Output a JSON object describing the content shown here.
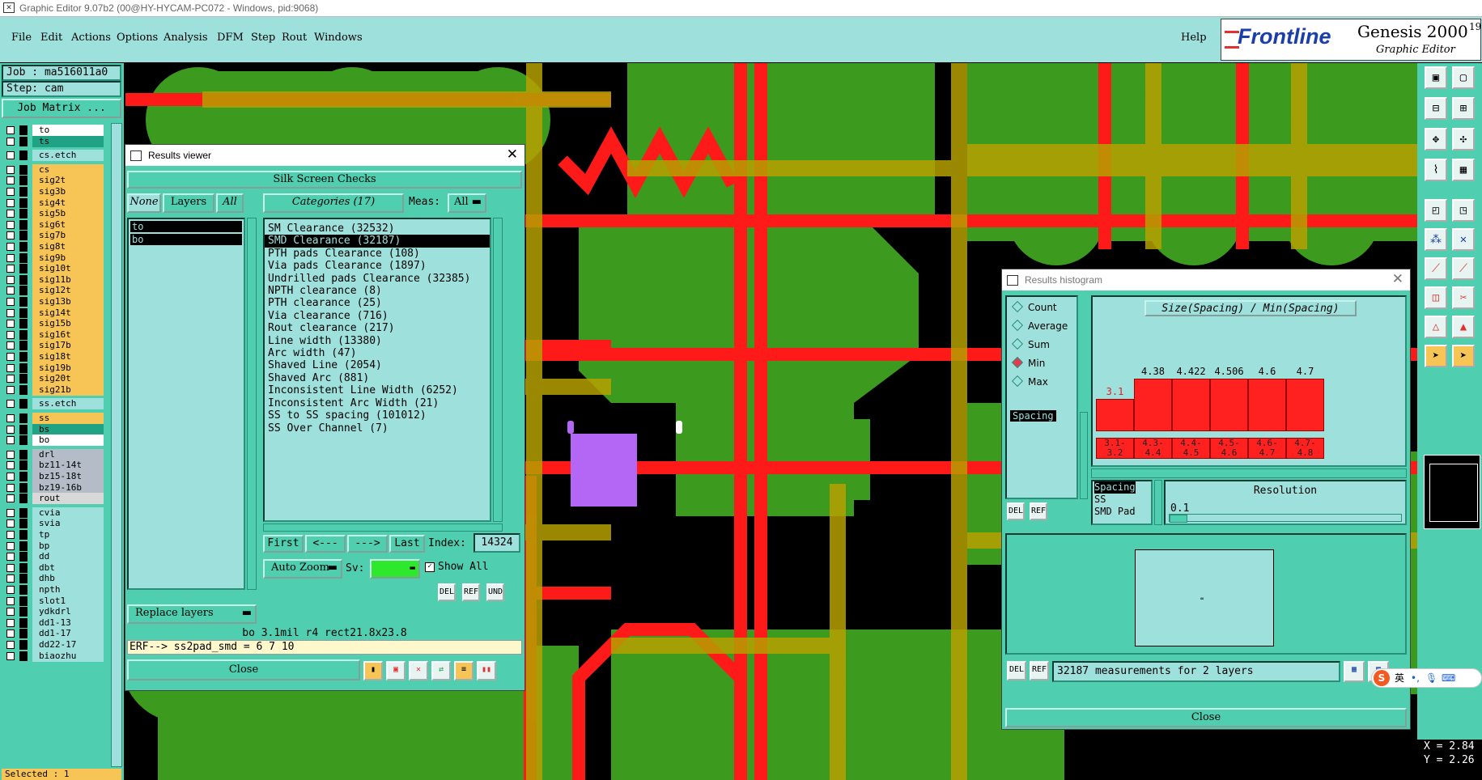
{
  "window": {
    "title": "Graphic Editor 9.07b2 (00@HY-HYCAM-PC072 - Windows, pid:9068)"
  },
  "menu": [
    "File",
    "Edit",
    "Actions",
    "Options",
    "Analysis",
    "DFM",
    "Step",
    "Rout",
    "Windows"
  ],
  "help": "Help",
  "brand": {
    "logo": "Frontline",
    "product": "Genesis 2000",
    "sup": "19",
    "sub": "Graphic Editor"
  },
  "job": {
    "job": "Job : ma516011a0",
    "step": "Step: cam",
    "matrix": "Job Matrix ..."
  },
  "layers": [
    {
      "name": "to",
      "color": "#ffffff"
    },
    {
      "name": "ts",
      "color": "#1fa384"
    },
    {
      "name": "cs.etch",
      "color": "#9ee0dc"
    },
    {
      "name": "cs",
      "color": "#f6c555"
    },
    {
      "name": "sig2t",
      "color": "#f6c555"
    },
    {
      "name": "sig3b",
      "color": "#f6c555"
    },
    {
      "name": "sig4t",
      "color": "#f6c555"
    },
    {
      "name": "sig5b",
      "color": "#f6c555"
    },
    {
      "name": "sig6t",
      "color": "#f6c555"
    },
    {
      "name": "sig7b",
      "color": "#f6c555"
    },
    {
      "name": "sig8t",
      "color": "#f6c555"
    },
    {
      "name": "sig9b",
      "color": "#f6c555"
    },
    {
      "name": "sig10t",
      "color": "#f6c555"
    },
    {
      "name": "sig11b",
      "color": "#f6c555"
    },
    {
      "name": "sig12t",
      "color": "#f6c555"
    },
    {
      "name": "sig13b",
      "color": "#f6c555"
    },
    {
      "name": "sig14t",
      "color": "#f6c555"
    },
    {
      "name": "sig15b",
      "color": "#f6c555"
    },
    {
      "name": "sig16t",
      "color": "#f6c555"
    },
    {
      "name": "sig17b",
      "color": "#f6c555"
    },
    {
      "name": "sig18t",
      "color": "#f6c555"
    },
    {
      "name": "sig19b",
      "color": "#f6c555"
    },
    {
      "name": "sig20t",
      "color": "#f6c555"
    },
    {
      "name": "sig21b",
      "color": "#f6c555"
    },
    {
      "name": "ss.etch",
      "color": "#9ee0dc"
    },
    {
      "name": "ss",
      "color": "#f6c555"
    },
    {
      "name": "bs",
      "color": "#1fa384"
    },
    {
      "name": "bo",
      "color": "#ffffff"
    },
    {
      "name": "drl",
      "color": "#b3bcc7"
    },
    {
      "name": "bz11-14t",
      "color": "#b3bcc7"
    },
    {
      "name": "bz15-18t",
      "color": "#b3bcc7"
    },
    {
      "name": "bz19-16b",
      "color": "#b3bcc7"
    },
    {
      "name": "rout",
      "color": "#d8d8d8"
    },
    {
      "name": "cvia",
      "color": "#9ee0dc"
    },
    {
      "name": "svia",
      "color": "#9ee0dc"
    },
    {
      "name": "tp",
      "color": "#9ee0dc"
    },
    {
      "name": "bp",
      "color": "#9ee0dc"
    },
    {
      "name": "dd",
      "color": "#9ee0dc"
    },
    {
      "name": "dbt",
      "color": "#9ee0dc"
    },
    {
      "name": "dhb",
      "color": "#9ee0dc"
    },
    {
      "name": "npth",
      "color": "#9ee0dc"
    },
    {
      "name": "slot1",
      "color": "#9ee0dc"
    },
    {
      "name": "ydkdrl",
      "color": "#9ee0dc"
    },
    {
      "name": "dd1-13",
      "color": "#9ee0dc"
    },
    {
      "name": "dd1-17",
      "color": "#9ee0dc"
    },
    {
      "name": "dd22-17",
      "color": "#9ee0dc"
    },
    {
      "name": "biaozhu",
      "color": "#9ee0dc"
    }
  ],
  "selected": "Selected : 1",
  "results_viewer": {
    "title": "Results viewer",
    "header": "Silk Screen Checks",
    "none": "None",
    "layers": "Layers",
    "all": "All",
    "categories": "Categories (17)",
    "meas_label": "Meas:",
    "meas_value": "All",
    "layer_list": [
      "to",
      "bo"
    ],
    "category_list": [
      "SM Clearance (32532)",
      "SMD Clearance (32187)",
      "PTH pads Clearance (108)",
      "Via pads Clearance (1897)",
      "Undrilled pads Clearance (32385)",
      "NPTH clearance (8)",
      "PTH clearance (25)",
      "Via clearance (716)",
      "Rout clearance (217)",
      "Line width (13380)",
      "Arc width (47)",
      "Shaved Line (2054)",
      "Shaved Arc (881)",
      "Inconsistent Line Width (6252)",
      "Inconsistent Arc Width (21)",
      "SS to SS spacing (101012)",
      "SS Over Channel (7)"
    ],
    "first": "First",
    "prev": "<---",
    "next": "--->",
    "last": "Last",
    "index_label": "Index:",
    "index_value": "14324",
    "replace_layers": "Replace layers",
    "auto_zoom": "Auto Zoom",
    "sv": "Sv:",
    "show_all": "Show All",
    "info": "bo 3.1mil  r4  rect21.8x23.8",
    "erf": "ERF--> ss2pad_smd = 6 7 10",
    "close": "Close",
    "del": "DEL",
    "ref": "REF",
    "und": "UND"
  },
  "histogram": {
    "title": "Results histogram",
    "modes": [
      {
        "label": "Count",
        "on": false
      },
      {
        "label": "Average",
        "on": false
      },
      {
        "label": "Sum",
        "on": false
      },
      {
        "label": "Min",
        "on": true
      },
      {
        "label": "Max",
        "on": false
      }
    ],
    "spacing_tag": "Spacing",
    "chart_title": "Size(Spacing) / Min(Spacing)",
    "bars": [
      {
        "value": "3.1",
        "range": "3.1- 3.2",
        "h": 0.52,
        "red": true
      },
      {
        "value": "4.38",
        "range": "4.3- 4.4",
        "h": 0.86,
        "red": false
      },
      {
        "value": "4.422",
        "range": "4.4- 4.5",
        "h": 0.86,
        "red": false
      },
      {
        "value": "4.506",
        "range": "4.5- 4.6",
        "h": 0.86,
        "red": false
      },
      {
        "value": "4.6",
        "range": "4.6- 4.7",
        "h": 0.86,
        "red": false
      },
      {
        "value": "4.7",
        "range": "4.7- 4.8",
        "h": 0.86,
        "red": false
      }
    ],
    "info_lines": [
      "Spacing",
      "SS",
      "SMD Pad"
    ],
    "resolution_label": "Resolution",
    "resolution_value": "0.1",
    "measurements": "32187 measurements for 2 layers",
    "close": "Close",
    "del": "DEL",
    "ref": "REF"
  },
  "coords": {
    "x": "X = 2.84",
    "y": "Y = 2.26"
  },
  "ime": "英"
}
